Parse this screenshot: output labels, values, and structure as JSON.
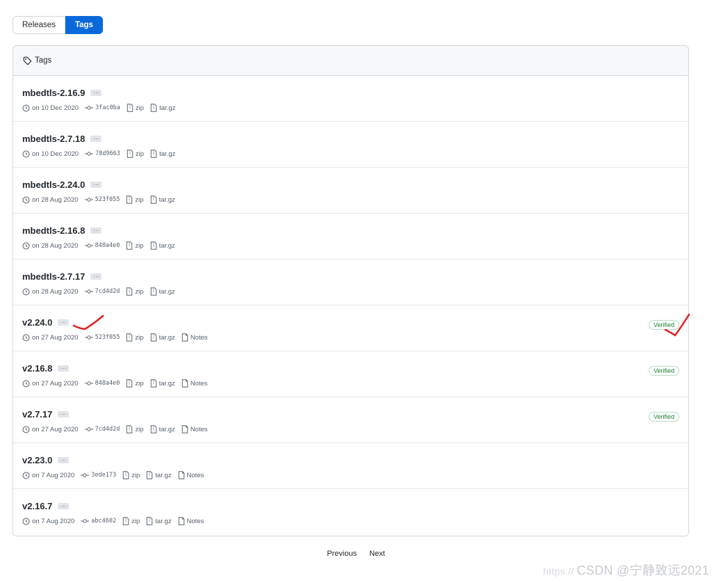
{
  "toggle": {
    "releases_label": "Releases",
    "tags_label": "Tags"
  },
  "header": {
    "title": "Tags",
    "icon": "tag-icon"
  },
  "tags": [
    {
      "name": "mbedtls-2.16.9",
      "date": "on 10 Dec 2020",
      "sha": "3fac0ba",
      "zip": "zip",
      "targz": "tar.gz",
      "notes": "",
      "verified": ""
    },
    {
      "name": "mbedtls-2.7.18",
      "date": "on 10 Dec 2020",
      "sha": "78d9663",
      "zip": "zip",
      "targz": "tar.gz",
      "notes": "",
      "verified": ""
    },
    {
      "name": "mbedtls-2.24.0",
      "date": "on 28 Aug 2020",
      "sha": "523f055",
      "zip": "zip",
      "targz": "tar.gz",
      "notes": "",
      "verified": ""
    },
    {
      "name": "mbedtls-2.16.8",
      "date": "on 28 Aug 2020",
      "sha": "848a4e0",
      "zip": "zip",
      "targz": "tar.gz",
      "notes": "",
      "verified": ""
    },
    {
      "name": "mbedtls-2.7.17",
      "date": "on 28 Aug 2020",
      "sha": "7cd4d2d",
      "zip": "zip",
      "targz": "tar.gz",
      "notes": "",
      "verified": ""
    },
    {
      "name": "v2.24.0",
      "date": "on 27 Aug 2020",
      "sha": "523f055",
      "zip": "zip",
      "targz": "tar.gz",
      "notes": "Notes",
      "verified": "Verified"
    },
    {
      "name": "v2.16.8",
      "date": "on 27 Aug 2020",
      "sha": "848a4e0",
      "zip": "zip",
      "targz": "tar.gz",
      "notes": "Notes",
      "verified": "Verified"
    },
    {
      "name": "v2.7.17",
      "date": "on 27 Aug 2020",
      "sha": "7cd4d2d",
      "zip": "zip",
      "targz": "tar.gz",
      "notes": "Notes",
      "verified": "Verified"
    },
    {
      "name": "v2.23.0",
      "date": "on 7 Aug 2020",
      "sha": "3ede173",
      "zip": "zip",
      "targz": "tar.gz",
      "notes": "Notes",
      "verified": ""
    },
    {
      "name": "v2.16.7",
      "date": "on 7 Aug 2020",
      "sha": "abc4602",
      "zip": "zip",
      "targz": "tar.gz",
      "notes": "Notes",
      "verified": ""
    }
  ],
  "ellipsis": "…",
  "pagination": {
    "previous": "Previous",
    "next": "Next"
  },
  "watermark": {
    "url": "https://",
    "text": "CSDN @宁静致远2021"
  },
  "colors": {
    "accent": "#0969da",
    "verified": "#1a7f37",
    "annotation": "#e02020"
  }
}
